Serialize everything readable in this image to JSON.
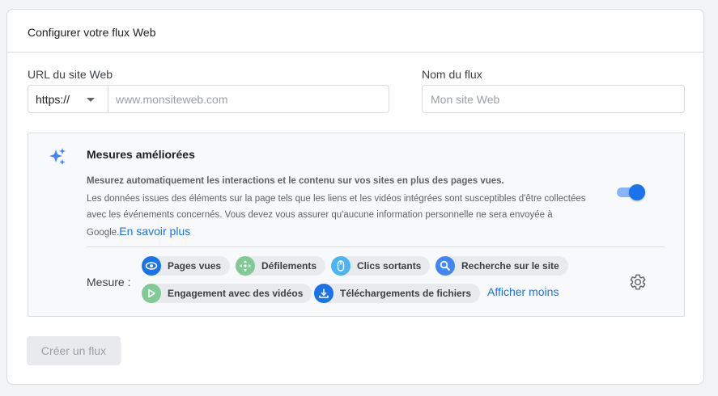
{
  "header": {
    "title": "Configurer votre flux Web"
  },
  "url_field": {
    "label": "URL du site Web",
    "protocol_value": "https://",
    "placeholder": "www.monsiteweb.com",
    "value": ""
  },
  "name_field": {
    "label": "Nom du flux",
    "placeholder": "Mon site Web",
    "value": ""
  },
  "enhanced": {
    "title": "Mesures améliorées",
    "desc_bold": "Mesurez automatiquement les interactions et le contenu sur vos sites en plus des pages vues.",
    "desc": "Les données issues des éléments sur la page tels que les liens et les vidéos intégrées sont susceptibles d'être collectées avec les événements concernés. Vous devez vous assurer qu'aucune information personnelle ne sera envoyée à Google.",
    "learn_more": "En savoir plus",
    "toggle_on": true,
    "measure_label": "Mesure :",
    "chips": [
      {
        "label": "Pages vues",
        "icon": "eye-icon",
        "color": "#1a73e8"
      },
      {
        "label": "Défilements",
        "icon": "scroll-arrows-icon",
        "color": "#81c995"
      },
      {
        "label": "Clics sortants",
        "icon": "mouse-icon",
        "color": "#4ab4f5"
      },
      {
        "label": "Recherche sur le site",
        "icon": "search-icon",
        "color": "#4285f4"
      },
      {
        "label": "Engagement avec des vidéos",
        "icon": "play-icon",
        "color": "#81c995"
      },
      {
        "label": "Téléchargements de fichiers",
        "icon": "download-icon",
        "color": "#1a73e8"
      }
    ],
    "show_less": "Afficher moins",
    "settings_icon": "gear-icon"
  },
  "create_button": {
    "label": "Créer un flux",
    "disabled": true
  }
}
